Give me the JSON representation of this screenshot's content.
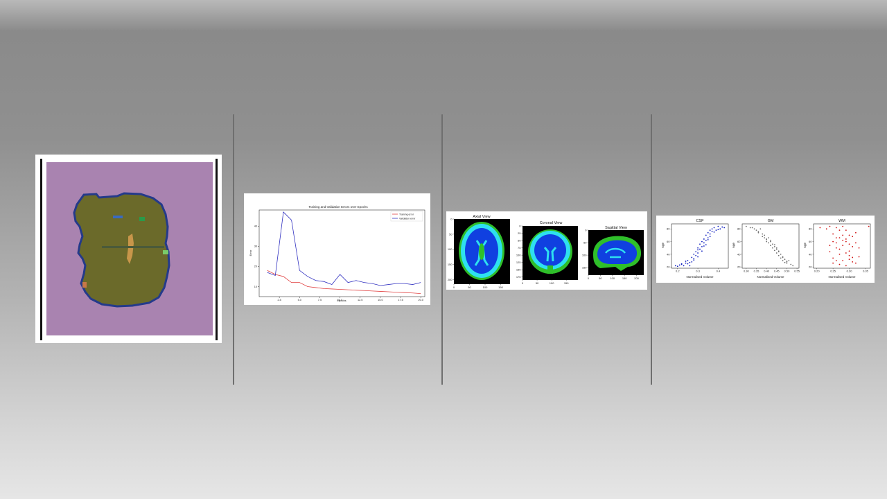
{
  "colors": {
    "panel_bg": "#ffffff",
    "divider": "#6f6f6f",
    "seg_background": "#a983b0",
    "seg_brain": "#6b6a2a",
    "seg_edge": "#243a8a",
    "mri_bg": "#000000",
    "csf_cyan": "#2ee0f0",
    "gm_green": "#2fbf2a",
    "wm_blue": "#1040e0",
    "train_red": "#e04040",
    "valid_blue": "#3030c0",
    "scatter_csf": "#1020c0",
    "scatter_gm": "#707070",
    "scatter_wm": "#d01010"
  },
  "chart_data": [
    {
      "type": "line",
      "title": "Training and Validation Errors over Epochs",
      "xlabel": "Epochs",
      "ylabel": "Error",
      "xlim": [
        0,
        20.5
      ],
      "ylim": [
        5,
        48
      ],
      "xticks": [
        "2.5",
        "5.0",
        "7.5",
        "10.0",
        "12.5",
        "15.0",
        "17.5",
        "20.0"
      ],
      "xtick_values": [
        2.5,
        5.0,
        7.5,
        10.0,
        12.5,
        15.0,
        17.5,
        20.0
      ],
      "yticks": [
        "10",
        "20",
        "30",
        "40"
      ],
      "ytick_values": [
        10,
        20,
        30,
        40
      ],
      "legend_position": "top-right",
      "x": [
        1,
        2,
        3,
        4,
        5,
        6,
        7,
        8,
        9,
        10,
        11,
        12,
        13,
        14,
        15,
        16,
        17,
        18,
        19,
        20
      ],
      "series": [
        {
          "name": "Training error",
          "color": "#e04040",
          "values": [
            18,
            16,
            15,
            12,
            12,
            10,
            9.5,
            9,
            8.8,
            8.6,
            8.4,
            8.2,
            8,
            7.8,
            7.6,
            7.4,
            7.2,
            7,
            6.8,
            6.5
          ]
        },
        {
          "name": "Validation error",
          "color": "#3030c0",
          "values": [
            17,
            15.5,
            47,
            43,
            18,
            15,
            13,
            12.5,
            11,
            16,
            12,
            13,
            12,
            11.5,
            10.5,
            11,
            11.5,
            11.5,
            11,
            12
          ]
        }
      ]
    },
    {
      "type": "scatter",
      "title": "CSF",
      "xlabel": "Normalised Volume",
      "ylabel": "Age",
      "xlim": [
        0.17,
        0.45
      ],
      "ylim": [
        18,
        88
      ],
      "xticks": [
        "0.2",
        "0.3",
        "0.4"
      ],
      "xtick_values": [
        0.2,
        0.3,
        0.4
      ],
      "yticks": [
        "20",
        "40",
        "60",
        "80"
      ],
      "ytick_values": [
        20,
        40,
        60,
        80
      ],
      "color": "#1020c0",
      "x": [
        0.19,
        0.2,
        0.21,
        0.22,
        0.23,
        0.24,
        0.25,
        0.25,
        0.26,
        0.27,
        0.27,
        0.28,
        0.28,
        0.29,
        0.29,
        0.3,
        0.3,
        0.31,
        0.31,
        0.32,
        0.32,
        0.33,
        0.33,
        0.34,
        0.34,
        0.35,
        0.35,
        0.36,
        0.36,
        0.37,
        0.37,
        0.38,
        0.39,
        0.4,
        0.41,
        0.42,
        0.43,
        0.26,
        0.28,
        0.3,
        0.32,
        0.34,
        0.36,
        0.38,
        0.24,
        0.22,
        0.3,
        0.33,
        0.35,
        0.4
      ],
      "y": [
        22,
        21,
        23,
        24,
        22,
        26,
        25,
        30,
        22,
        28,
        35,
        33,
        40,
        38,
        44,
        42,
        50,
        48,
        56,
        52,
        60,
        58,
        64,
        62,
        70,
        66,
        74,
        72,
        78,
        76,
        80,
        82,
        78,
        84,
        80,
        83,
        82,
        27,
        31,
        36,
        45,
        55,
        68,
        75,
        29,
        25,
        47,
        53,
        63,
        79
      ]
    },
    {
      "type": "scatter",
      "title": "GM",
      "xlabel": "Normalised Volume",
      "ylabel": "Age",
      "xlim": [
        0.28,
        0.56
      ],
      "ylim": [
        18,
        88
      ],
      "xticks": [
        "0.30",
        "0.35",
        "0.40",
        "0.45",
        "0.50",
        "0.55"
      ],
      "xtick_values": [
        0.3,
        0.35,
        0.4,
        0.45,
        0.5,
        0.55
      ],
      "yticks": [
        "20",
        "40",
        "60",
        "80"
      ],
      "ytick_values": [
        20,
        40,
        60,
        80
      ],
      "color": "#707070",
      "x": [
        0.3,
        0.32,
        0.34,
        0.35,
        0.36,
        0.37,
        0.38,
        0.38,
        0.39,
        0.4,
        0.4,
        0.41,
        0.41,
        0.42,
        0.42,
        0.43,
        0.43,
        0.44,
        0.44,
        0.45,
        0.45,
        0.46,
        0.46,
        0.47,
        0.47,
        0.48,
        0.48,
        0.49,
        0.5,
        0.5,
        0.51,
        0.52,
        0.53,
        0.36,
        0.39,
        0.42,
        0.44,
        0.46,
        0.48,
        0.5,
        0.33,
        0.4,
        0.45,
        0.49
      ],
      "y": [
        84,
        82,
        80,
        78,
        76,
        80,
        72,
        68,
        70,
        64,
        60,
        66,
        58,
        60,
        54,
        56,
        50,
        52,
        46,
        48,
        42,
        44,
        38,
        40,
        34,
        36,
        30,
        32,
        28,
        26,
        30,
        24,
        22,
        74,
        66,
        62,
        55,
        45,
        35,
        29,
        82,
        63,
        50,
        27
      ]
    },
    {
      "type": "scatter",
      "title": "WM",
      "xlabel": "Normalised Volume",
      "ylabel": "Age",
      "xlim": [
        0.19,
        0.365
      ],
      "ylim": [
        18,
        88
      ],
      "xticks": [
        "0.20",
        "0.25",
        "0.30",
        "0.35"
      ],
      "xtick_values": [
        0.2,
        0.25,
        0.3,
        0.35
      ],
      "yticks": [
        "20",
        "40",
        "60",
        "80"
      ],
      "ytick_values": [
        20,
        40,
        60,
        80
      ],
      "color": "#d01010",
      "x": [
        0.21,
        0.23,
        0.24,
        0.25,
        0.25,
        0.26,
        0.26,
        0.27,
        0.27,
        0.28,
        0.28,
        0.29,
        0.29,
        0.3,
        0.3,
        0.31,
        0.31,
        0.32,
        0.32,
        0.33,
        0.24,
        0.25,
        0.26,
        0.27,
        0.28,
        0.29,
        0.3,
        0.31,
        0.32,
        0.26,
        0.28,
        0.3,
        0.27,
        0.29,
        0.25,
        0.28,
        0.3,
        0.31,
        0.33,
        0.36,
        0.26,
        0.29,
        0.24,
        0.27
      ],
      "y": [
        82,
        80,
        84,
        72,
        60,
        82,
        50,
        78,
        40,
        70,
        30,
        64,
        22,
        56,
        45,
        68,
        35,
        58,
        26,
        50,
        44,
        34,
        66,
        24,
        54,
        78,
        38,
        28,
        74,
        58,
        62,
        70,
        48,
        42,
        26,
        84,
        32,
        52,
        36,
        84,
        30,
        60,
        54,
        66
      ]
    }
  ],
  "mri_views": [
    {
      "title": "Axial View",
      "xticks": [
        "0",
        "50",
        "100",
        "150"
      ],
      "yticks": [
        "0",
        "50",
        "100",
        "150",
        "200"
      ]
    },
    {
      "title": "Coronal View",
      "xticks": [
        "0",
        "50",
        "100",
        "150"
      ],
      "yticks": [
        "0",
        "25",
        "50",
        "75",
        "100",
        "125",
        "150",
        "175"
      ]
    },
    {
      "title": "Sagittal View",
      "xticks": [
        "0",
        "50",
        "100",
        "150",
        "200"
      ],
      "yticks": [
        "0",
        "50",
        "100",
        "150"
      ]
    }
  ]
}
